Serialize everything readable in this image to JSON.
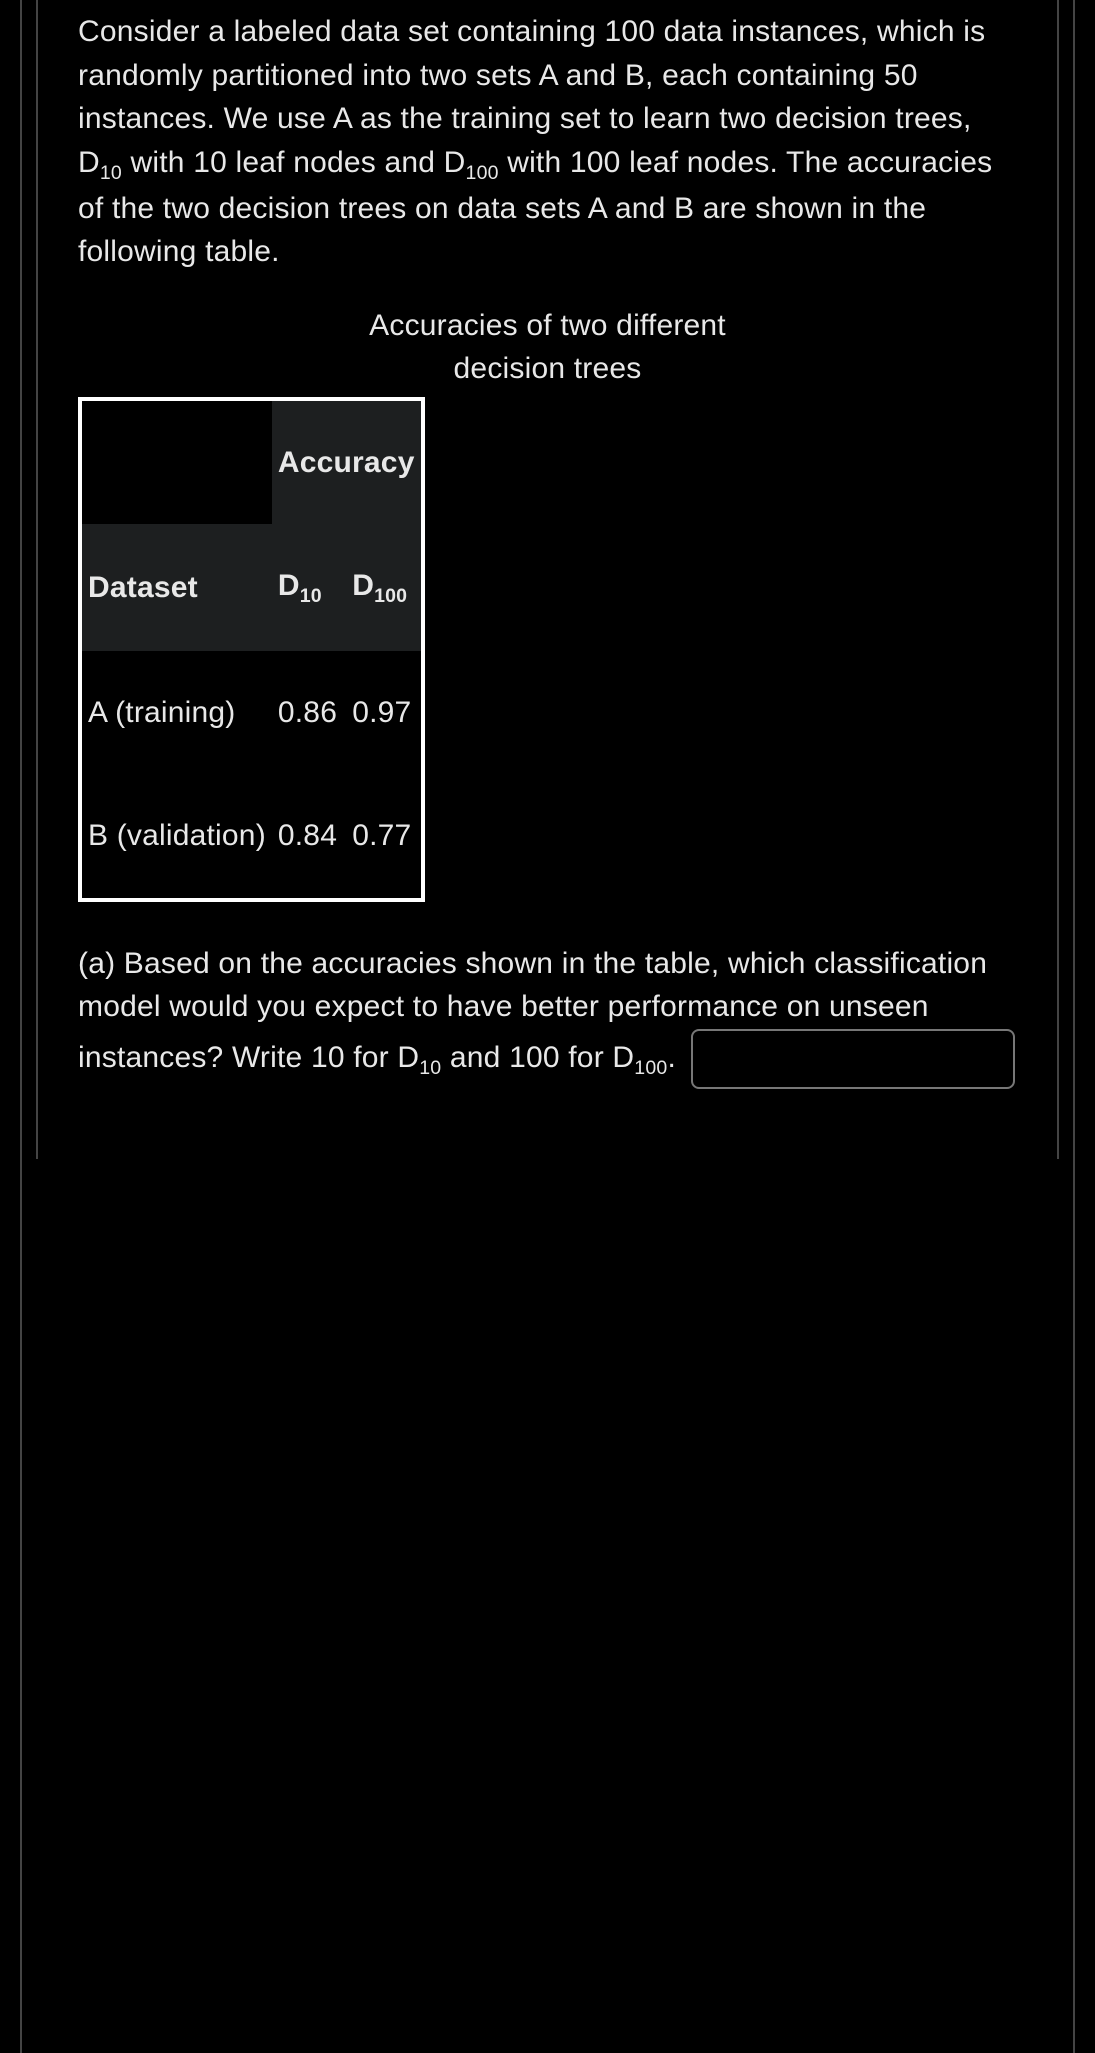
{
  "intro": {
    "p1a": "Consider a labeled data set containing 100 data instances, which is randomly partitioned into two sets A and B, each containing 50 instances. We use A as the training set to learn two decision trees, D",
    "sub1": "10",
    "p1b": " with 10 leaf nodes and D",
    "sub2": "100",
    "p1c": " with 100 leaf nodes. The accuracies of the two decision trees on data sets A and B are shown in the following table."
  },
  "table": {
    "caption": "Accuracies of two different decision trees",
    "head_accuracy": "Accuracy",
    "head_dataset": "Dataset",
    "head_d10_pre": "D",
    "head_d10_sub": "10",
    "head_d100_pre": "D",
    "head_d100_sub": "100",
    "row1_label": "A (training)",
    "row1_d10": "0.86",
    "row1_d100": "0.97",
    "row2_label": "B (validation)",
    "row2_d10": "0.84",
    "row2_d100": "0.77"
  },
  "q": {
    "a_pre": "(a) Based on the accuracies shown in the table, which classification model would you expect to have better performance on unseen instances? Write 10 for D",
    "a_sub1": "10",
    "a_mid": " and 100 for D",
    "a_sub2": "100",
    "a_post": ". ",
    "answer_value": ""
  }
}
